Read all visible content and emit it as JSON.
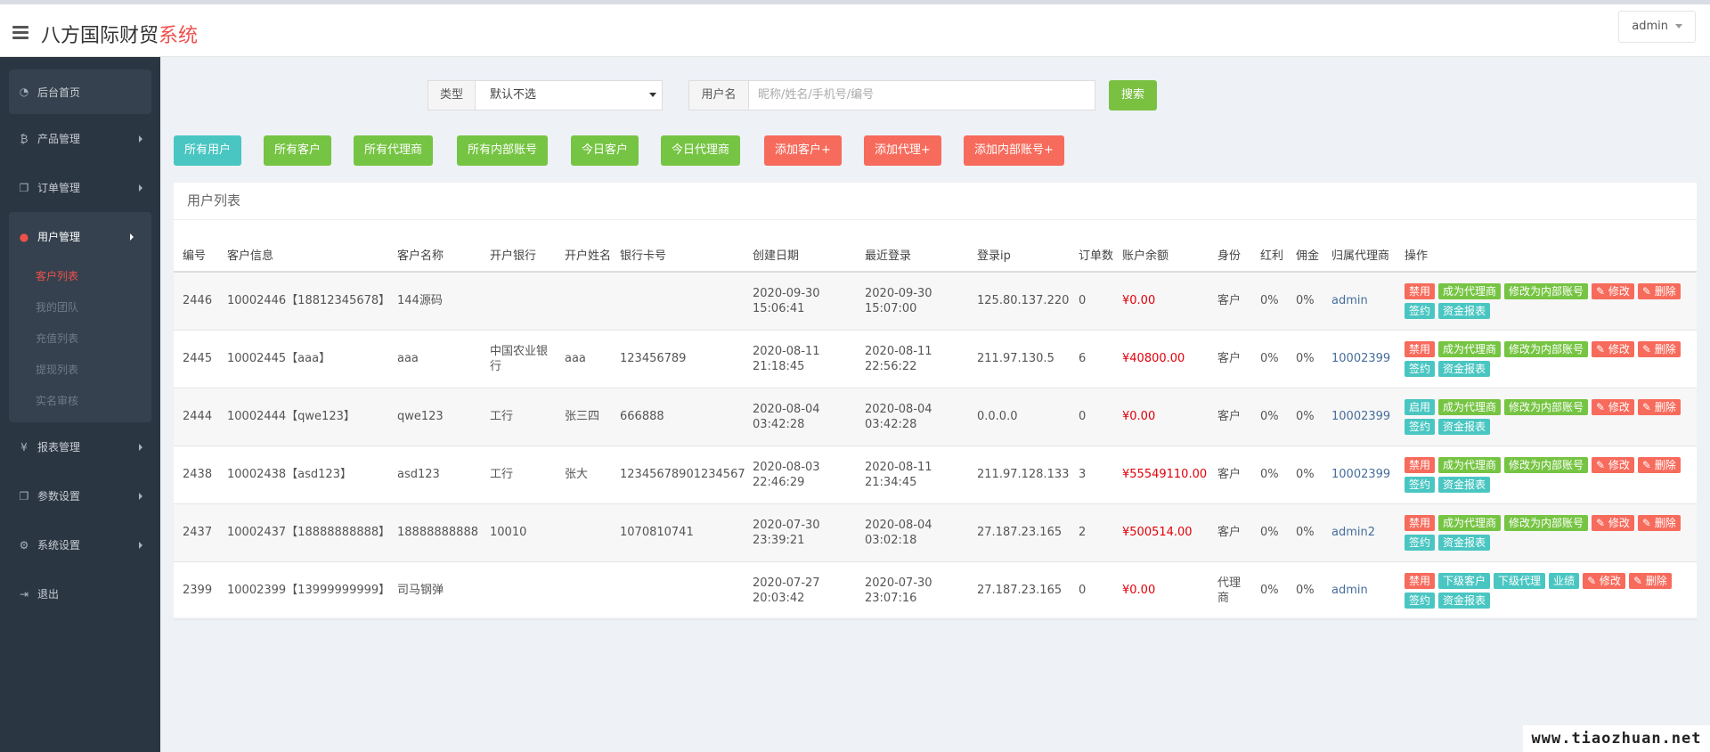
{
  "header": {
    "brand_main": "八方国际财贸",
    "brand_accent": "系统",
    "user_menu": "admin"
  },
  "sidebar": {
    "home": "后台首页",
    "items": [
      {
        "label": "产品管理",
        "icon": "bitcoin-icon"
      },
      {
        "label": "订单管理",
        "icon": "copy-icon"
      },
      {
        "label": "用户管理",
        "icon": "user-icon"
      },
      {
        "label": "报表管理",
        "icon": "yen-icon"
      },
      {
        "label": "参数设置",
        "icon": "copy-icon"
      },
      {
        "label": "系统设置",
        "icon": "gears-icon"
      },
      {
        "label": "退出",
        "icon": "sign-out-icon"
      }
    ],
    "user_sub": [
      "客户列表",
      "我的团队",
      "充值列表",
      "提现列表",
      "实名审核"
    ]
  },
  "search": {
    "type_label": "类型",
    "type_value": "默认不选",
    "user_label": "用户名",
    "user_placeholder": "昵称/姓名/手机号/编号",
    "search_button": "搜索"
  },
  "filters": [
    "所有用户",
    "所有客户",
    "所有代理商",
    "所有内部账号",
    "今日客户",
    "今日代理商",
    "添加客户+",
    "添加代理+",
    "添加内部账号+"
  ],
  "table": {
    "title": "用户列表",
    "headers": [
      "编号",
      "客户信息",
      "客户名称",
      "开户银行",
      "开户姓名",
      "银行卡号",
      "创建日期",
      "最近登录",
      "登录ip",
      "订单数",
      "账户余额",
      "身份",
      "红利",
      "佣金",
      "归属代理商",
      "操作"
    ],
    "rows": [
      {
        "id": "2446",
        "info": "10002446【18812345678】",
        "name": "144源码",
        "bank": "",
        "holder": "",
        "card": "",
        "created_date": "2020-09-30",
        "created_time": "15:06:41",
        "login_date": "2020-09-30",
        "login_time": "15:07:00",
        "ip": "125.80.137.220",
        "orders": "0",
        "balance": "¥0.00",
        "role": "客户",
        "bonus": "0%",
        "commission": "0%",
        "agent": "admin",
        "ops": [
          {
            "l": "禁用",
            "c": "red"
          },
          {
            "l": "成为代理商",
            "c": "green"
          },
          {
            "l": "修改为内部账号",
            "c": "green"
          },
          {
            "l": "✎ 修改",
            "c": "red"
          },
          {
            "l": "✎ 删除",
            "c": "red"
          },
          {
            "l": "签约",
            "c": "teal"
          },
          {
            "l": "资金报表",
            "c": "teal"
          }
        ]
      },
      {
        "id": "2445",
        "info": "10002445【aaa】",
        "name": "aaa",
        "bank": "中国农业银行",
        "holder": "aaa",
        "card": "123456789",
        "created_date": "2020-08-11",
        "created_time": "21:18:45",
        "login_date": "2020-08-11",
        "login_time": "22:56:22",
        "ip": "211.97.130.5",
        "orders": "6",
        "balance": "¥40800.00",
        "role": "客户",
        "bonus": "0%",
        "commission": "0%",
        "agent": "10002399",
        "ops": [
          {
            "l": "禁用",
            "c": "red"
          },
          {
            "l": "成为代理商",
            "c": "green"
          },
          {
            "l": "修改为内部账号",
            "c": "green"
          },
          {
            "l": "✎ 修改",
            "c": "red"
          },
          {
            "l": "✎ 删除",
            "c": "red"
          },
          {
            "l": "签约",
            "c": "teal"
          },
          {
            "l": "资金报表",
            "c": "teal"
          }
        ]
      },
      {
        "id": "2444",
        "info": "10002444【qwe123】",
        "name": "qwe123",
        "bank": "工行",
        "holder": "张三四",
        "card": "666888",
        "created_date": "2020-08-04",
        "created_time": "03:42:28",
        "login_date": "2020-08-04",
        "login_time": "03:42:28",
        "ip": "0.0.0.0",
        "orders": "0",
        "balance": "¥0.00",
        "role": "客户",
        "bonus": "0%",
        "commission": "0%",
        "agent": "10002399",
        "ops": [
          {
            "l": "启用",
            "c": "teal"
          },
          {
            "l": "成为代理商",
            "c": "green"
          },
          {
            "l": "修改为内部账号",
            "c": "green"
          },
          {
            "l": "✎ 修改",
            "c": "red"
          },
          {
            "l": "✎ 删除",
            "c": "red"
          },
          {
            "l": "签约",
            "c": "teal"
          },
          {
            "l": "资金报表",
            "c": "teal"
          }
        ]
      },
      {
        "id": "2438",
        "info": "10002438【asd123】",
        "name": "asd123",
        "bank": "工行",
        "holder": "张大",
        "card": "12345678901234567",
        "created_date": "2020-08-03",
        "created_time": "22:46:29",
        "login_date": "2020-08-11",
        "login_time": "21:34:45",
        "ip": "211.97.128.133",
        "orders": "3",
        "balance": "¥55549110.00",
        "role": "客户",
        "bonus": "0%",
        "commission": "0%",
        "agent": "10002399",
        "ops": [
          {
            "l": "禁用",
            "c": "red"
          },
          {
            "l": "成为代理商",
            "c": "green"
          },
          {
            "l": "修改为内部账号",
            "c": "green"
          },
          {
            "l": "✎ 修改",
            "c": "red"
          },
          {
            "l": "✎ 删除",
            "c": "red"
          },
          {
            "l": "签约",
            "c": "teal"
          },
          {
            "l": "资金报表",
            "c": "teal"
          }
        ]
      },
      {
        "id": "2437",
        "info": "10002437【18888888888】",
        "name": "18888888888",
        "bank": "10010",
        "holder": "",
        "card": "1070810741",
        "created_date": "2020-07-30",
        "created_time": "23:39:21",
        "login_date": "2020-08-04",
        "login_time": "03:02:18",
        "ip": "27.187.23.165",
        "orders": "2",
        "balance": "¥500514.00",
        "role": "客户",
        "bonus": "0%",
        "commission": "0%",
        "agent": "admin2",
        "ops": [
          {
            "l": "禁用",
            "c": "red"
          },
          {
            "l": "成为代理商",
            "c": "green"
          },
          {
            "l": "修改为内部账号",
            "c": "green"
          },
          {
            "l": "✎ 修改",
            "c": "red"
          },
          {
            "l": "✎ 删除",
            "c": "red"
          },
          {
            "l": "签约",
            "c": "teal"
          },
          {
            "l": "资金报表",
            "c": "teal"
          }
        ]
      },
      {
        "id": "2399",
        "info": "10002399【13999999999】",
        "name": "司马钢弹",
        "bank": "",
        "holder": "",
        "card": "",
        "created_date": "2020-07-27",
        "created_time": "20:03:42",
        "login_date": "2020-07-30",
        "login_time": "23:07:16",
        "ip": "27.187.23.165",
        "orders": "0",
        "balance": "¥0.00",
        "role": "代理商",
        "bonus": "0%",
        "commission": "0%",
        "agent": "admin",
        "ops": [
          {
            "l": "禁用",
            "c": "red"
          },
          {
            "l": "下级客户",
            "c": "teal"
          },
          {
            "l": "下级代理",
            "c": "teal"
          },
          {
            "l": "业绩",
            "c": "teal"
          },
          {
            "l": "✎ 修改",
            "c": "red"
          },
          {
            "l": "✎ 删除",
            "c": "red"
          },
          {
            "l": "签约",
            "c": "teal"
          },
          {
            "l": "资金报表",
            "c": "teal"
          }
        ]
      }
    ]
  },
  "watermark": "www.tiaozhuan.net"
}
